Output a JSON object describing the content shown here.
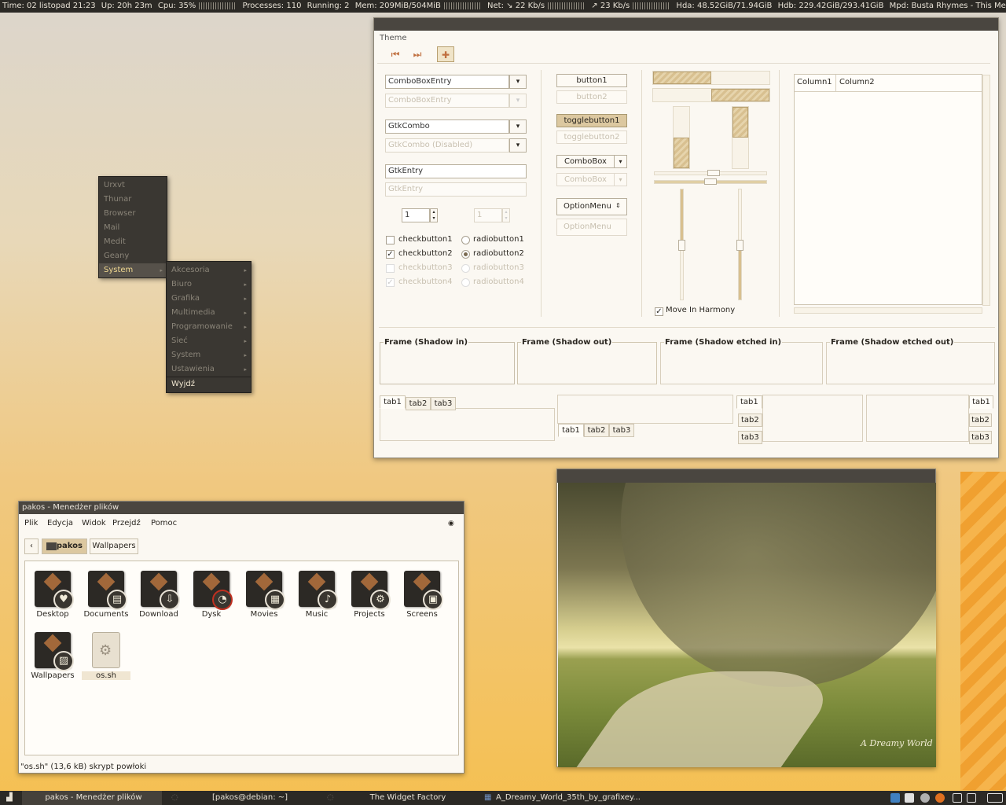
{
  "conky": {
    "time": "Time: 02 listopad 21:23",
    "up": "Up: 20h 23m",
    "cpu": "Cpu: 35%",
    "processes": "Processes: 110",
    "running": "Running: 2",
    "mem": "Mem: 209MiB/504MiB",
    "net": "Net: ↘ 22 Kb/s",
    "net_up": "↗ 23 Kb/s",
    "hda": "Hda: 48.52GiB/71.94GiB",
    "hdb": "Hdb: 229.42GiB/293.41GiB",
    "mpd": "Mpd: Busta Rhymes - This Means War!! (Fe"
  },
  "theme_window": {
    "title": "Theme",
    "combos": {
      "cbe": "ComboBoxEntry",
      "cbe_dis": "ComboBoxEntry",
      "gtkcombo": "GtkCombo",
      "gtkcombo_dis": "GtkCombo (Disabled)",
      "entry": "GtkEntry",
      "entry_dis": "GtkEntry",
      "spin": "1",
      "spin_dis": "1"
    },
    "checks": [
      "checkbutton1",
      "checkbutton2",
      "checkbutton3",
      "checkbutton4"
    ],
    "radios": [
      "radiobutton1",
      "radiobutton2",
      "radiobutton3",
      "radiobutton4"
    ],
    "buttons": {
      "b1": "button1",
      "b2": "button2",
      "t1": "togglebutton1",
      "t2": "togglebutton2",
      "combo": "ComboBox",
      "combo_dis": "ComboBox",
      "opt": "OptionMenu",
      "opt_dis": "OptionMenu"
    },
    "move_harmony": "Move In Harmony",
    "columns": [
      "Column1",
      "Column2"
    ],
    "frames": [
      "Frame (Shadow in)",
      "Frame (Shadow out)",
      "Frame (Shadow etched in)",
      "Frame (Shadow etched out)"
    ],
    "tabs": [
      "tab1",
      "tab2",
      "tab3"
    ]
  },
  "menu": {
    "items": [
      "Urxvt",
      "Thunar",
      "Browser",
      "Mail",
      "Medit",
      "Geany",
      "System"
    ],
    "submenu": [
      "Akcesoria",
      "Biuro",
      "Grafika",
      "Multimedia",
      "Programowanie",
      "Sieć",
      "System",
      "Ustawienia",
      "Wyjdź"
    ]
  },
  "file_manager": {
    "title": "pakos - Menedżer plików",
    "menubar": [
      "Plik",
      "Edycja",
      "Widok",
      "Przejdź",
      "Pomoc"
    ],
    "path": [
      "pakos",
      "Wallpapers"
    ],
    "files": [
      {
        "name": "Desktop",
        "icon": "heart-icon"
      },
      {
        "name": "Documents",
        "icon": "document-icon"
      },
      {
        "name": "Download",
        "icon": "download-icon"
      },
      {
        "name": "Dysk",
        "icon": "disk-icon"
      },
      {
        "name": "Movies",
        "icon": "film-icon"
      },
      {
        "name": "Music",
        "icon": "music-icon"
      },
      {
        "name": "Projects",
        "icon": "gear-icon"
      },
      {
        "name": "Screens",
        "icon": "photos-icon"
      },
      {
        "name": "Wallpapers",
        "icon": "image-icon"
      },
      {
        "name": "os.sh",
        "icon": "script-icon"
      }
    ],
    "status": "\"os.sh\" (13,6 kB) skrypt powłoki"
  },
  "taskbar": {
    "tasks": [
      "pakos - Menedżer plików",
      "[pakos@debian: ~]",
      "The Widget Factory",
      "A_Dreamy_World_35th_by_grafixey..."
    ]
  },
  "photo": {
    "watermark": "A Dreamy World"
  },
  "colors": {
    "accent": "#f0c060",
    "panel": "#2b2925",
    "window_bg": "#fbf8f2"
  }
}
